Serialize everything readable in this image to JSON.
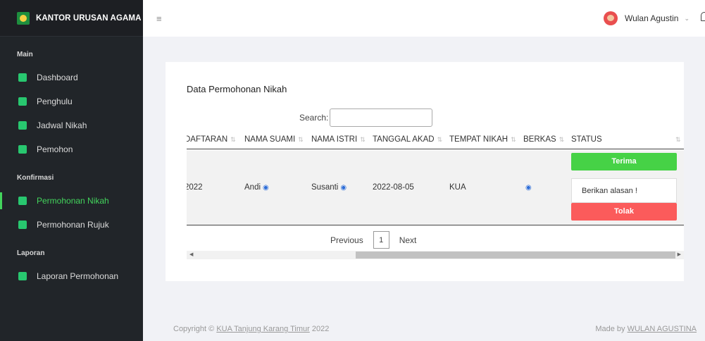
{
  "brand": {
    "name": "KANTOR URUSAN AGAMA"
  },
  "sidebar": {
    "sections": [
      {
        "title": "Main",
        "items": [
          {
            "label": "Dashboard",
            "icon": "dashboard-icon"
          },
          {
            "label": "Penghulu",
            "icon": "id-card-icon"
          },
          {
            "label": "Jadwal Nikah",
            "icon": "calendar-icon"
          },
          {
            "label": "Pemohon",
            "icon": "user-card-icon"
          }
        ]
      },
      {
        "title": "Konfirmasi",
        "items": [
          {
            "label": "Permohonan Nikah",
            "icon": "command-icon",
            "active": true
          },
          {
            "label": "Permohonan Rujuk",
            "icon": "blocks-icon"
          }
        ]
      },
      {
        "title": "Laporan",
        "items": [
          {
            "label": "Laporan Permohonan",
            "icon": "printer-icon"
          }
        ]
      }
    ]
  },
  "header": {
    "user_name": "Wulan Agustin"
  },
  "card": {
    "title": "Data Permohonan Nikah",
    "search_label": "Search:",
    "search_value": "",
    "columns": [
      "DAFTARAN",
      "NAMA SUAMI",
      "NAMA ISTRI",
      "TANGGAL AKAD",
      "TEMPAT NIKAH",
      "BERKAS",
      "STATUS"
    ],
    "row": {
      "daftaran": "2022",
      "suami": "Andi",
      "istri": "Susanti",
      "tanggal": "2022-08-05",
      "tempat": "KUA"
    },
    "accept_label": "Terima",
    "reason_placeholder": "Berikan alasan !",
    "reject_label": "Tolak",
    "pager": {
      "prev": "Previous",
      "page": "1",
      "next": "Next"
    }
  },
  "footer": {
    "copyright_prefix": "Copyright ©",
    "copyright_link": "KUA Tanjung Karang Timur",
    "copyright_year": "2022",
    "made_by_prefix": "Made by",
    "made_by_link": "WULAN AGUSTINA"
  },
  "colors": {
    "sidebar_bg": "#212529",
    "accent_green": "#43d45c",
    "accept": "#46d246",
    "reject": "#fb5b5b"
  }
}
